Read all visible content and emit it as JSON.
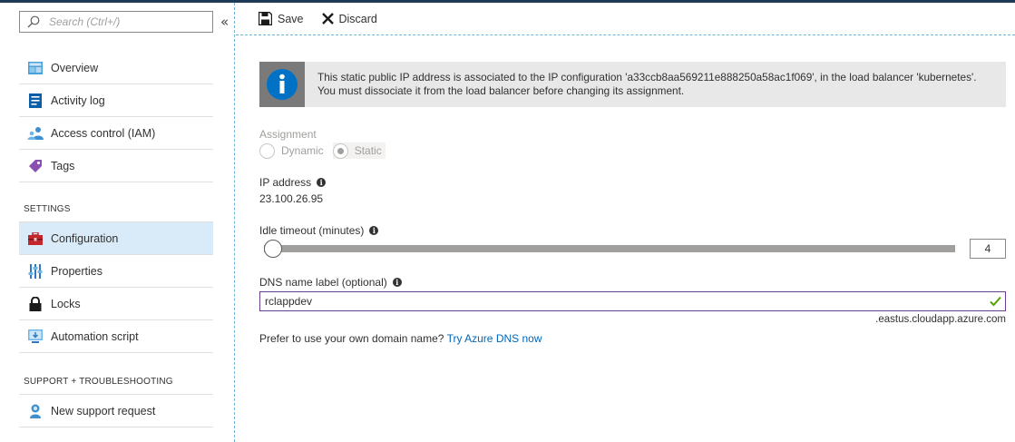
{
  "sidebar": {
    "search_placeholder": "Search (Ctrl+/)",
    "collapse_label": "«",
    "items": [
      {
        "label": "Overview",
        "icon": "overview-icon"
      },
      {
        "label": "Activity log",
        "icon": "activity-log-icon"
      },
      {
        "label": "Access control (IAM)",
        "icon": "access-control-icon"
      },
      {
        "label": "Tags",
        "icon": "tag-icon"
      }
    ],
    "settings_title": "SETTINGS",
    "settings_items": [
      {
        "label": "Configuration",
        "icon": "configuration-icon",
        "active": true
      },
      {
        "label": "Properties",
        "icon": "properties-icon"
      },
      {
        "label": "Locks",
        "icon": "lock-icon"
      },
      {
        "label": "Automation script",
        "icon": "automation-script-icon"
      }
    ],
    "support_title": "SUPPORT + TROUBLESHOOTING",
    "support_items": [
      {
        "label": "New support request",
        "icon": "support-request-icon"
      }
    ]
  },
  "toolbar": {
    "save_label": "Save",
    "discard_label": "Discard"
  },
  "info_banner": {
    "line1": "This static public IP address is associated to the IP configuration 'a33ccb8aa569211e888250a58ac1f069', in the load balancer 'kubernetes'.",
    "line2": "You must dissociate it from the load balancer before changing its assignment."
  },
  "assignment": {
    "label": "Assignment",
    "options": [
      "Dynamic",
      "Static"
    ],
    "selected": "Static"
  },
  "ip_address": {
    "label": "IP address",
    "value": "23.100.26.95"
  },
  "idle_timeout": {
    "label": "Idle timeout (minutes)",
    "value": "4",
    "slider_fraction": 0
  },
  "dns": {
    "label": "DNS name label (optional)",
    "value": "rclappdev",
    "suffix": ".eastus.cloudapp.azure.com",
    "prefer_text": "Prefer to use your own domain name?",
    "link_text": "Try Azure DNS now"
  },
  "colors": {
    "accent": "#0067b8",
    "valid": "#57a300",
    "active_nav": "#d9ebf9",
    "input_border": "#6b3e8e"
  }
}
